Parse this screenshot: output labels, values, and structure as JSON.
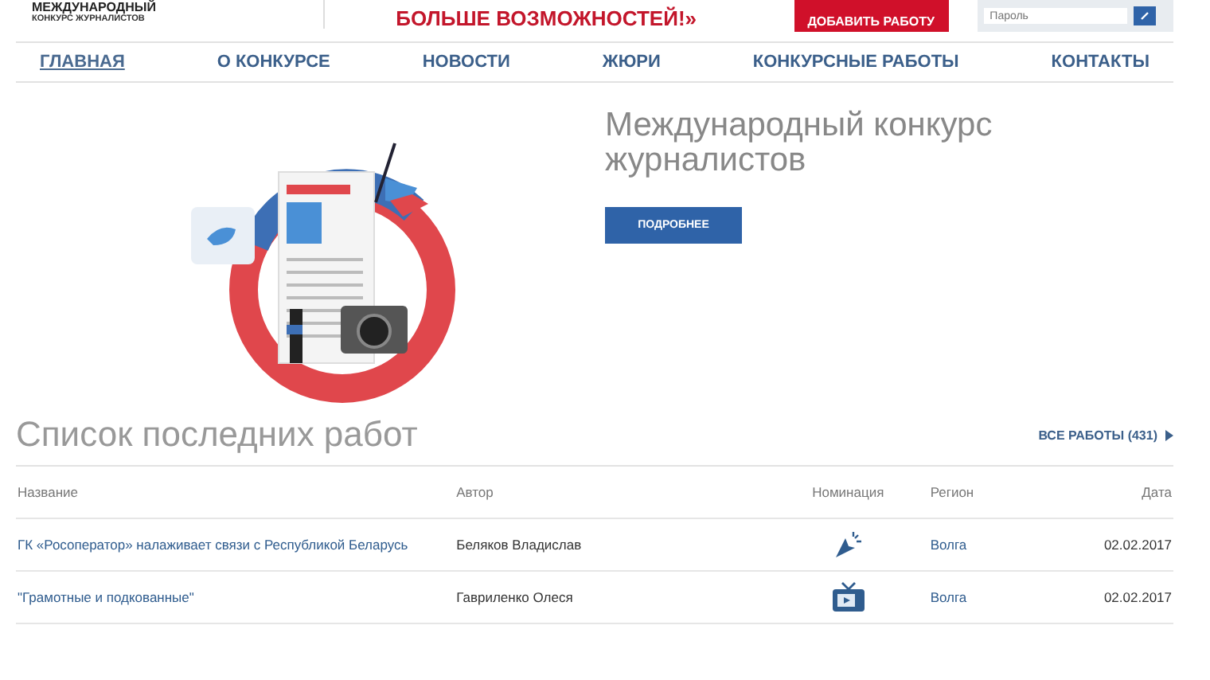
{
  "header": {
    "logo_line_1": "МЕЖДУНАРОДНЫЙ",
    "logo_line_2": "КОНКУРС ЖУРНАЛИСТОВ",
    "slogan": "БОЛЬШЕ ВОЗМОЖНОСТЕЙ!»",
    "add_button": "ДОБАВИТЬ РАБОТУ",
    "password_placeholder": "Пароль"
  },
  "nav": [
    {
      "label": "ГЛАВНАЯ",
      "selected": true
    },
    {
      "label": "О КОНКУРСЕ",
      "selected": false
    },
    {
      "label": "НОВОСТИ",
      "selected": false
    },
    {
      "label": "ЖЮРИ",
      "selected": false
    },
    {
      "label": "КОНКУРСНЫЕ РАБОТЫ",
      "selected": false
    },
    {
      "label": "КОНТАКТЫ",
      "selected": false
    }
  ],
  "hero": {
    "title": "Международный конкурс журналистов",
    "button": "ПОДРОБНЕЕ"
  },
  "works": {
    "title": "Список последних работ",
    "all_link": "ВСЕ РАБОТЫ (431)",
    "columns": [
      "Название",
      "Автор",
      "Номинация",
      "Регион",
      "Дата"
    ],
    "rows": [
      {
        "title": "ГК «Росоператор» налаживает связи с Республикой Беларусь",
        "author": "Беляков Владислав",
        "nomination": {
          "kind": "cursor"
        },
        "region": "Волга",
        "date": "02.02.2017"
      },
      {
        "title": "\"Грамотные и подкованные\"",
        "author": "Гавриленко Олеся",
        "nomination": {
          "kind": "tv"
        },
        "region": "Волга",
        "date": "02.02.2017"
      }
    ]
  }
}
